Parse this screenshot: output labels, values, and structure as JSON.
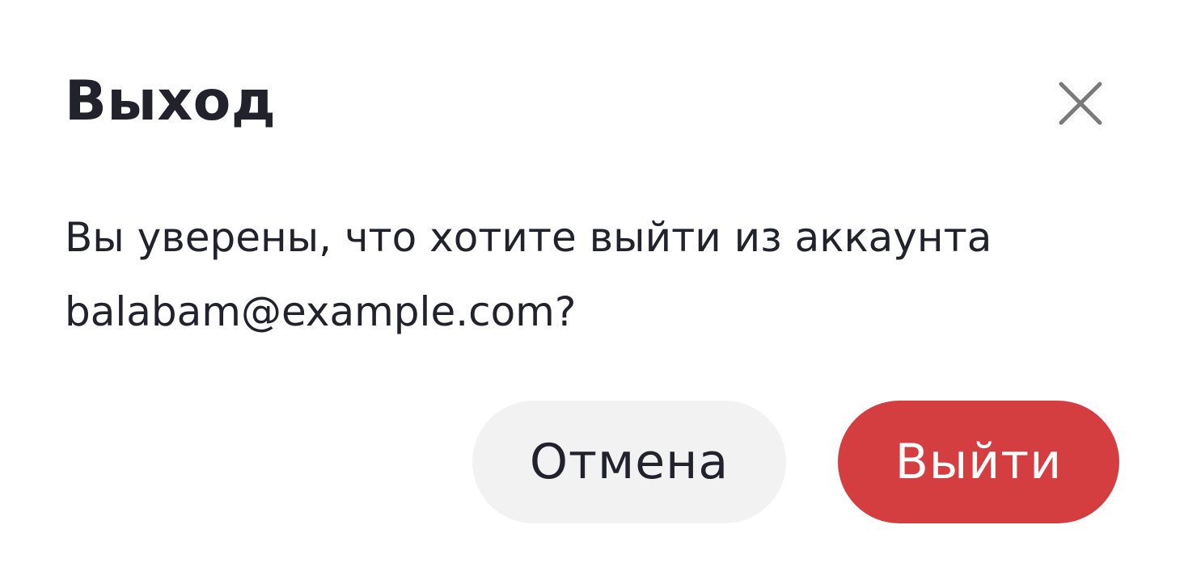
{
  "dialog": {
    "title": "Выход",
    "message_line1": "Вы уверены, что хотите выйти из аккаунта",
    "message_line2": "balabam@example.com?",
    "close_icon": "close-icon",
    "cancel_label": "Отмена",
    "confirm_label": "Выйти"
  },
  "colors": {
    "text": "#22222c",
    "close_icon": "#7a7a7a",
    "cancel_bg": "#f2f2f3",
    "confirm_bg": "#d43e40",
    "confirm_text": "#ffffff"
  }
}
